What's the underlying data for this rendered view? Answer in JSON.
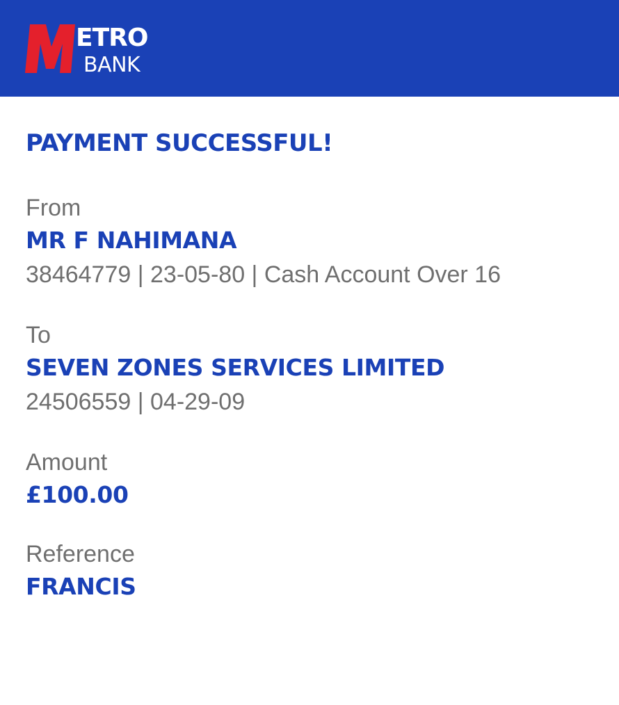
{
  "brand": {
    "name_top": "ETRO",
    "name_bottom": "BANK",
    "initial": "M",
    "primary_color": "#1a41b6",
    "logo_red": "#e4202c"
  },
  "confirmation": {
    "title": "PAYMENT SUCCESSFUL!",
    "from": {
      "label": "From",
      "name": "MR F NAHIMANA",
      "details": "38464779 | 23-05-80 | Cash Account Over 16"
    },
    "to": {
      "label": "To",
      "name": "SEVEN ZONES SERVICES LIMITED",
      "details": "24506559 | 04-29-09"
    },
    "amount": {
      "label": "Amount",
      "value": "£100.00"
    },
    "reference": {
      "label": "Reference",
      "value": "FRANCIS"
    }
  }
}
